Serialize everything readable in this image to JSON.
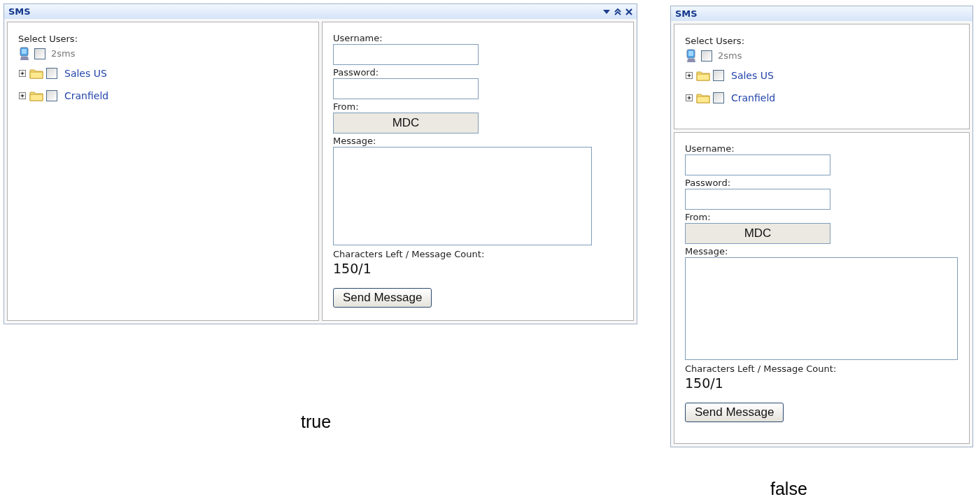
{
  "examples": [
    {
      "caption": "true",
      "kind": "horizontal",
      "title": "SMS",
      "header_icons": true,
      "users_label": "Select Users:",
      "tree": [
        {
          "kind": "computer",
          "label": "2sms",
          "checked": false
        },
        {
          "kind": "folder",
          "label": "Sales US",
          "checked": false,
          "expanded": false
        },
        {
          "kind": "folder",
          "label": "Cranfield",
          "checked": false,
          "expanded": false
        }
      ],
      "username_label": "Username:",
      "password_label": "Password:",
      "from_label": "From:",
      "from_value": "MDC",
      "message_label": "Message:",
      "count_label": "Characters Left / Message Count:",
      "count_value": "150/1",
      "send_button": "Send Message"
    },
    {
      "caption": "false",
      "kind": "vertical",
      "title": "SMS",
      "header_icons": false,
      "users_label": "Select Users:",
      "tree": [
        {
          "kind": "computer",
          "label": "2sms",
          "checked": false
        },
        {
          "kind": "folder",
          "label": "Sales US",
          "checked": false,
          "expanded": false
        },
        {
          "kind": "folder",
          "label": "Cranfield",
          "checked": false,
          "expanded": false
        }
      ],
      "username_label": "Username:",
      "password_label": "Password:",
      "from_label": "From:",
      "from_value": "MDC",
      "message_label": "Message:",
      "count_label": "Characters Left / Message Count:",
      "count_value": "150/1",
      "send_button": "Send Message"
    }
  ]
}
